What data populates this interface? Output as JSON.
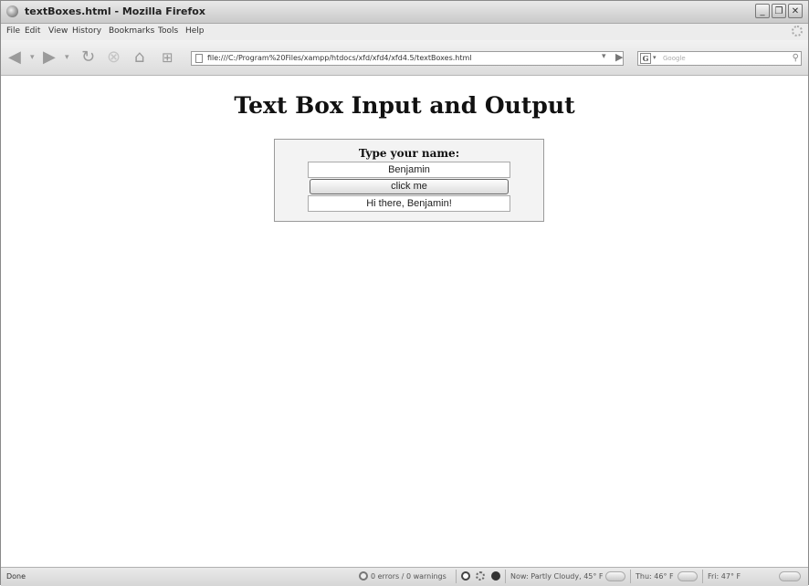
{
  "window": {
    "title": "textBoxes.html - Mozilla Firefox",
    "controls": [
      "_",
      "❐",
      "✕"
    ]
  },
  "menu": {
    "items": [
      "File",
      "Edit",
      "View",
      "History",
      "Bookmarks",
      "Tools",
      "Help"
    ]
  },
  "nav": {
    "url": "file:///C:/Program%20Files/xampp/htdocs/xfd/xfd4/xfd4.5/textBoxes.html",
    "search_placeholder": "Google",
    "search_engine_letter": "G"
  },
  "page": {
    "heading": "Text Box Input and Output",
    "prompt_label": "Type your name:",
    "name_value": "Benjamin",
    "button_label": "click me",
    "output_value": "Hi there, Benjamin!"
  },
  "status": {
    "text": "Done",
    "errors": "0 errors / 0 warnings",
    "weather_now": "Now: Partly Cloudy, 45° F",
    "weather_thu": "Thu: 46° F",
    "weather_fri": "Fri: 47° F"
  }
}
